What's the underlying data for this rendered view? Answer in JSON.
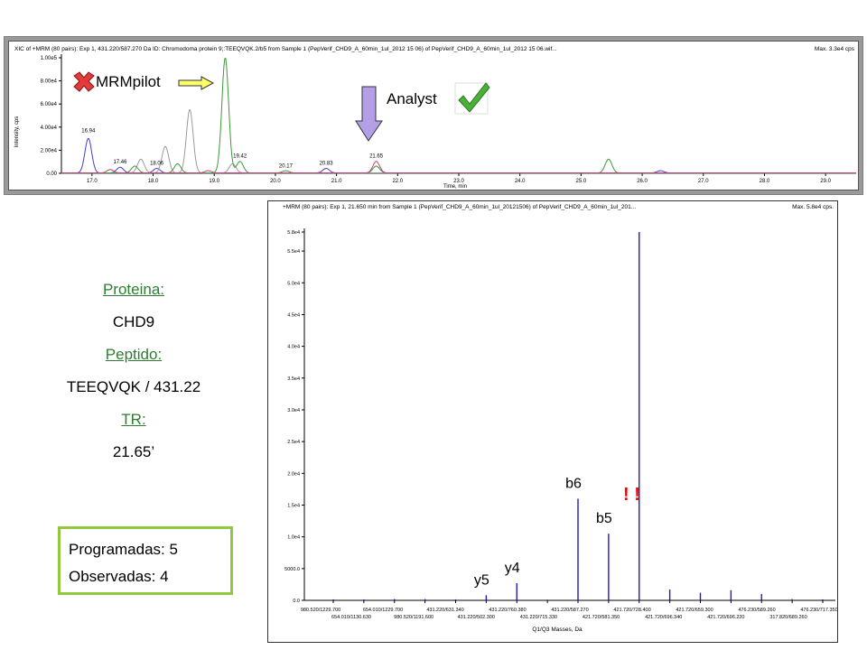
{
  "xic": {
    "header": "XIC of +MRM (80 pairs): Exp 1, 431.220/587.270 Da ID: Chromodoma protein 9;:TEEQVQK.2/b5 from Sample 1 (PepVerif_CHD9_A_60min_1ul_2012 15 06) of PepVerif_CHD9_A_60min_1ul_2012 15 06.wif...",
    "max": "Max. 3.3e4 cps",
    "ylabel": "Intensity, cps",
    "xlabel": "Time, min",
    "y_ticks": [
      "0.00",
      "2.00e4",
      "4.00e4",
      "6.00e4",
      "8.00e4",
      "1.00e5"
    ],
    "x_ticks": [
      "17.0",
      "18.0",
      "19.0",
      "20.0",
      "21.0",
      "22.0",
      "23.0",
      "24.0",
      "25.0",
      "26.0",
      "27.0",
      "28.0",
      "29.0"
    ],
    "peak_labels": [
      "16.94",
      "17.46",
      "18.06",
      "19.42",
      "20.17",
      "20.83",
      "21.65"
    ]
  },
  "annotations": {
    "mrmpilot": "MRMpilot",
    "analyst": "Analyst",
    "exclaim": "! !",
    "cross_icon": "red-cross-icon",
    "check_icon": "green-check-icon",
    "arrow_color": "#ffff66",
    "down_arrow_color": "#b49ee6"
  },
  "info": {
    "protein_label": "Proteina:",
    "protein_value": "CHD9",
    "peptide_label": "Peptido:",
    "peptide_value": "TEEQVQK / 431.22",
    "tr_label": "TR:",
    "tr_value": "21.65’"
  },
  "counts": {
    "programmed": "Programadas: 5",
    "observed": "Observadas: 4"
  },
  "chart_data": [
    {
      "type": "line",
      "title": "XIC of +MRM (80 pairs): Exp 1, 431.220/587.270 Da ID: Chromodoma protein 9;:TEEQVQK.2/b5 from Sample 1 (PepVerif_CHD9_A_60min_1ul_2012 15 06) of PepVerif_CHD9_A_60min_1ul_2012 15 06.wif...",
      "xlabel": "Time, min",
      "ylabel": "Intensity, cps",
      "xlim": [
        16.5,
        29.5
      ],
      "ylim": [
        0,
        100000
      ],
      "series": [
        {
          "color": "#3f3fd0",
          "peaks": [
            {
              "x": 16.94,
              "y": 30000
            },
            {
              "x": 17.46,
              "y": 5000
            },
            {
              "x": 18.06,
              "y": 4000
            },
            {
              "x": 20.83,
              "y": 4000
            },
            {
              "x": 26.3,
              "y": 2000
            }
          ]
        },
        {
          "color": "#9a9a9a",
          "peaks": [
            {
              "x": 17.8,
              "y": 12000
            },
            {
              "x": 18.2,
              "y": 23000
            },
            {
              "x": 18.6,
              "y": 55000
            },
            {
              "x": 19.3,
              "y": 8000
            }
          ]
        },
        {
          "color": "#3a9a3a",
          "peaks": [
            {
              "x": 17.7,
              "y": 6000
            },
            {
              "x": 18.4,
              "y": 8000
            },
            {
              "x": 19.18,
              "y": 100000
            },
            {
              "x": 19.42,
              "y": 10000
            },
            {
              "x": 20.17,
              "y": 2000
            },
            {
              "x": 21.65,
              "y": 6000
            },
            {
              "x": 25.45,
              "y": 12000
            }
          ]
        },
        {
          "color": "#cc3a7a",
          "peaks": [
            {
              "x": 17.3,
              "y": 3000
            },
            {
              "x": 18.9,
              "y": 2000
            },
            {
              "x": 21.65,
              "y": 10000
            }
          ]
        }
      ]
    },
    {
      "type": "bar",
      "title": "+MRM (80 pairs): Exp 1, 21.650 min from Sample 1 (PepVerif_CHD9_A_60min_1ul_20121506) of PepVerif_CHD9_A_60min_1ul_201...",
      "max": "Max. 5.8e4 cps.",
      "xlabel": "Q1/Q3 Masses, Da",
      "ylim": [
        0,
        58000
      ],
      "y_ticks": [
        "0.0",
        "5000.0",
        "1.0e4",
        "1.5e4",
        "2.0e4",
        "2.5e4",
        "3.0e4",
        "3.5e4",
        "4.0e4",
        "4.5e4",
        "5.0e4",
        "5.5e4",
        "5.8e4"
      ],
      "categories_row1": [
        "980.520/1229.700",
        "654.010/1229.700",
        "431.220/631.340",
        "431.220/760.380",
        "431.220/587.270",
        "421.720/728.400",
        "421.720/659.300",
        "476.230/589.260",
        "476.230/717.350"
      ],
      "categories_row2": [
        "654.010/1130.630",
        "980.520/1191.600",
        "431.220/502.300",
        "431.220/715.330",
        "421.720/581.350",
        "421.720/696.340",
        "421.720/696.220",
        "317.820/689.260"
      ],
      "bars": [
        {
          "label": "",
          "value": 150
        },
        {
          "label": "",
          "value": 150
        },
        {
          "label": "",
          "value": 200
        },
        {
          "label": "",
          "value": 200
        },
        {
          "label": "",
          "value": 150
        },
        {
          "label": "y5",
          "value": 800
        },
        {
          "label": "y4",
          "value": 2700
        },
        {
          "label": "",
          "value": 100
        },
        {
          "label": "b6",
          "value": 16000
        },
        {
          "label": "b5",
          "value": 10500
        },
        {
          "label": "",
          "value": 58000
        },
        {
          "label": "",
          "value": 1700
        },
        {
          "label": "",
          "value": 1200
        },
        {
          "label": "",
          "value": 1600
        },
        {
          "label": "",
          "value": 1000
        },
        {
          "label": "",
          "value": 200
        },
        {
          "label": "",
          "value": 150
        }
      ]
    }
  ]
}
